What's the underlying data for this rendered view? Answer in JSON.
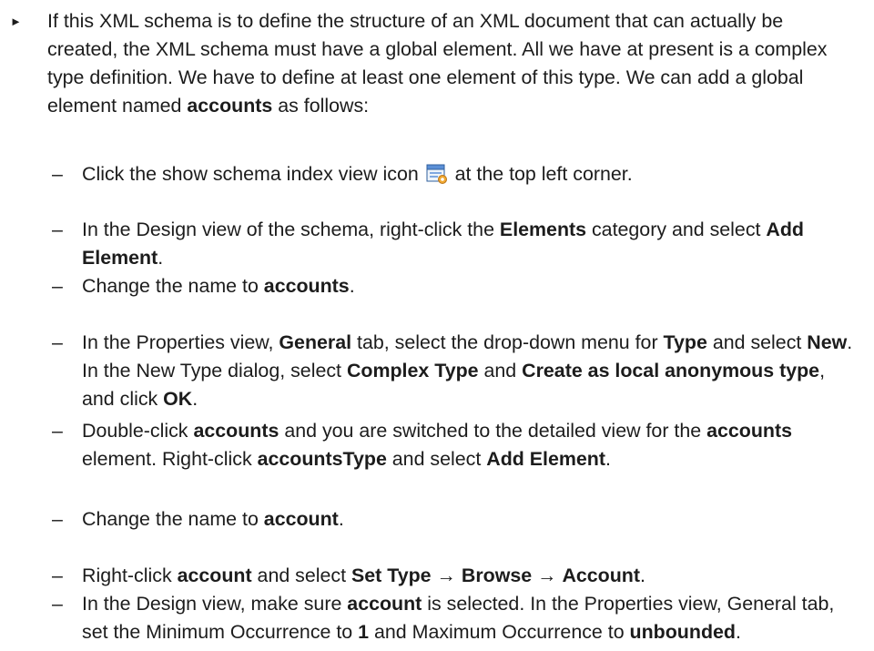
{
  "intro": {
    "bullet": "►",
    "text": [
      {
        "t": "If this XML schema is to define the structure of an XML document that can actually be created, the XML schema must have a global element. All we have at present is a complex type definition. We have to define at least one element of this type. We can add a global element named "
      },
      {
        "t": "accounts",
        "b": true
      },
      {
        "t": " as follows:"
      }
    ]
  },
  "dash": "–",
  "steps": [
    [
      {
        "t": "Click the show schema index view icon "
      },
      {
        "icon": "schema-index-view-icon"
      },
      {
        "t": " at the top left corner."
      }
    ],
    [
      {
        "t": "In the Design view of the schema, right-click the "
      },
      {
        "t": "Elements",
        "b": true
      },
      {
        "t": " category and select "
      },
      {
        "t": "Add Element",
        "b": true
      },
      {
        "t": "."
      }
    ],
    [
      {
        "t": "Change the name to "
      },
      {
        "t": "accounts",
        "b": true
      },
      {
        "t": "."
      }
    ],
    [
      {
        "t": "In the Properties view, "
      },
      {
        "t": "General",
        "b": true
      },
      {
        "t": " tab, select the drop-down menu for "
      },
      {
        "t": "Type",
        "b": true
      },
      {
        "t": " and select "
      },
      {
        "t": "New",
        "b": true
      },
      {
        "t": ". In the New Type dialog, select "
      },
      {
        "t": "Complex Type",
        "b": true
      },
      {
        "t": " and "
      },
      {
        "t": "Create as local anonymous type",
        "b": true
      },
      {
        "t": ", and click "
      },
      {
        "t": "OK",
        "b": true
      },
      {
        "t": "."
      }
    ],
    [
      {
        "t": "Double-click "
      },
      {
        "t": "accounts",
        "b": true
      },
      {
        "t": " and you are switched to the detailed view for the "
      },
      {
        "t": "accounts",
        "b": true
      },
      {
        "t": " element. Right-click "
      },
      {
        "t": "accountsType",
        "b": true
      },
      {
        "t": " and select "
      },
      {
        "t": "Add Element",
        "b": true
      },
      {
        "t": "."
      }
    ],
    [
      {
        "t": "Change the name to "
      },
      {
        "t": "account",
        "b": true
      },
      {
        "t": "."
      }
    ],
    [
      {
        "t": "Right-click "
      },
      {
        "t": "account",
        "b": true
      },
      {
        "t": " and select "
      },
      {
        "t": "Set Type",
        "b": true
      },
      {
        "t": " → "
      },
      {
        "t": "Browse",
        "b": true
      },
      {
        "t": " → "
      },
      {
        "t": "Account",
        "b": true
      },
      {
        "t": "."
      }
    ],
    [
      {
        "t": "In the Design view, make sure "
      },
      {
        "t": "account",
        "b": true
      },
      {
        "t": " is selected. In the Properties view, General tab, set the Minimum Occurrence to "
      },
      {
        "t": "1",
        "b": true
      },
      {
        "t": " and Maximum Occurrence to "
      },
      {
        "t": "unbounded",
        "b": true
      },
      {
        "t": "."
      }
    ]
  ]
}
